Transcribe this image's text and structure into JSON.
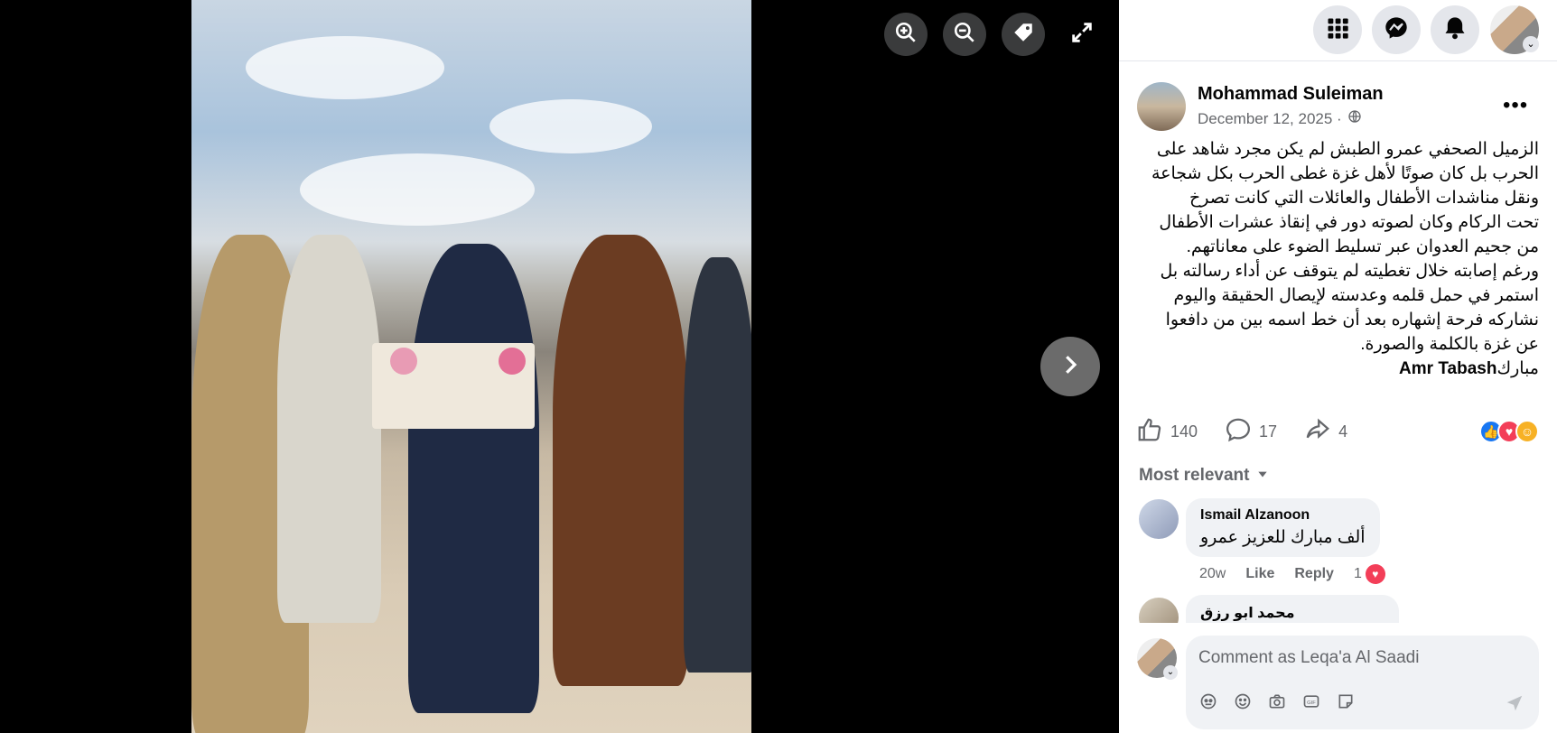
{
  "viewer": {
    "zoom_in_label": "Zoom in",
    "zoom_out_label": "Zoom out",
    "tag_label": "Tag",
    "fullscreen_label": "Enter full screen",
    "next_label": "Next photo"
  },
  "post": {
    "author": "Mohammad Suleiman",
    "date": "December 12, 2025 ·",
    "text_lines": [
      "الزميل الصحفي عمرو الطبش لم يكن مجرد شاهد على",
      "الحرب بل كان صوتًا لأهل غزة غطى الحرب بكل شجاعة",
      "ونقل مناشدات الأطفال والعائلات التي كانت تصرخ",
      "تحت الركام وكان لصوته دور في إنقاذ عشرات الأطفال",
      "من جحيم العدوان عبر تسليط الضوء على معاناتهم.",
      "ورغم إصابته خلال تغطيته لم يتوقف عن أداء رسالته بل",
      "استمر في حمل قلمه وعدسته لإيصال الحقيقة واليوم",
      "نشاركه فرحة إشهاره بعد أن خط اسمه بين من دافعوا",
      "عن غزة بالكلمة والصورة."
    ],
    "last_line_prefix": "مبارك",
    "last_line_name": "Amr Tabash",
    "likes": "140",
    "comments": "17",
    "shares": "4"
  },
  "comments": {
    "sort_label": "Most relevant",
    "items": [
      {
        "name": "Ismail Alzanoon",
        "text": "ألف مبارك للعزيز عمرو",
        "time": "20w",
        "like": "Like",
        "reply": "Reply",
        "reactions": "1"
      },
      {
        "name": "محمد ابو رزق",
        "text": ""
      }
    ],
    "composer_placeholder": "Comment as Leqa'a Al Saadi"
  },
  "colors": {
    "like_blue": "#1877f2",
    "love_red": "#f33e58",
    "haha_yellow": "#f7b125"
  }
}
